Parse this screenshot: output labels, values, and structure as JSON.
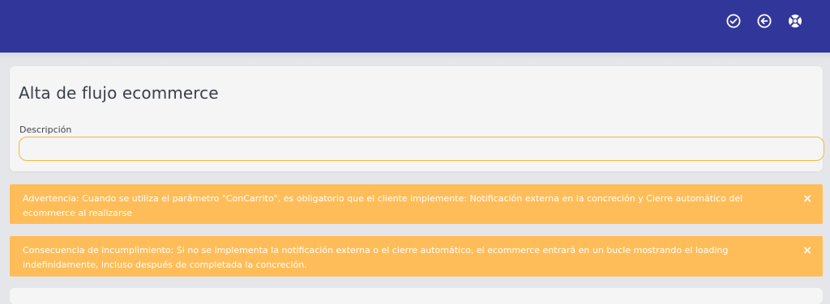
{
  "header": {
    "bg_color": "#31379a",
    "actions": [
      {
        "icon": "check-circle-icon",
        "name": "confirm-button"
      },
      {
        "icon": "arrow-left-circle-icon",
        "name": "back-button"
      },
      {
        "icon": "lifebuoy-icon",
        "name": "help-button"
      }
    ]
  },
  "form": {
    "title": "Alta de flujo ecommerce",
    "description_label": "Descripción",
    "description_value": "",
    "description_placeholder": ""
  },
  "alerts": [
    {
      "text": "Advertencia: Cuando se utiliza el parámetro \"ConCarrito\", es obligatorio que el cliente implemente: Notificación externa en la concreción y Cierre automático del ecommerce al realizarse",
      "close": "×"
    },
    {
      "text": "Consecuencia de incumplimiento: Si no se implementa la notificación externa o el cierre automático, el ecommerce entrará en un bucle mostrando el loading indefinidamente, incluso después de completada la concreción.",
      "close": "×"
    }
  ],
  "colors": {
    "alert_bg": "#ffbd59",
    "input_border": "#f5b942",
    "page_bg": "#e4e6ea"
  }
}
